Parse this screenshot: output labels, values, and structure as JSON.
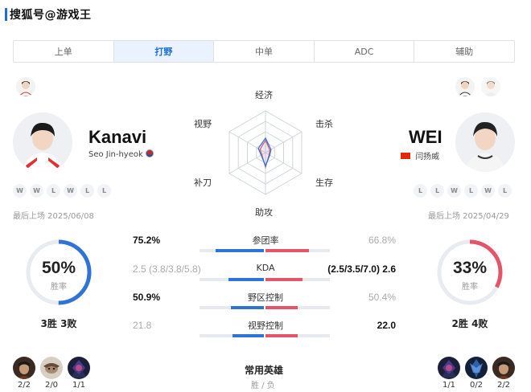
{
  "header": {
    "watermark": "搜狐号@游戏王"
  },
  "tabs": [
    {
      "label": "上单",
      "active": false
    },
    {
      "label": "打野",
      "active": true
    },
    {
      "label": "中单",
      "active": false
    },
    {
      "label": "ADC",
      "active": false
    },
    {
      "label": "辅助",
      "active": false
    }
  ],
  "left_player": {
    "name": "Kanavi",
    "realname": "Seo Jin-hyeok",
    "form": [
      "W",
      "W",
      "L",
      "W",
      "L",
      "L"
    ],
    "last_played": "最后上场 2025/06/08",
    "win_rate": "50%",
    "win_rate_value": 0.5,
    "win_rate_label": "胜率",
    "record": "3胜 3败",
    "champions": [
      {
        "record": "2/2"
      },
      {
        "record": "2/0"
      },
      {
        "record": "1/1"
      }
    ]
  },
  "right_player": {
    "name": "WEI",
    "realname": "闫扬威",
    "form": [
      "L",
      "L",
      "W",
      "L",
      "W",
      "L"
    ],
    "last_played": "最后上场 2025/04/29",
    "win_rate": "33%",
    "win_rate_value": 0.33,
    "win_rate_label": "胜率",
    "record": "2胜 4败",
    "champions": [
      {
        "record": "1/1"
      },
      {
        "record": "0/2"
      },
      {
        "record": "2/2"
      }
    ]
  },
  "radar": {
    "labels": {
      "top": "经济",
      "top_right": "击杀",
      "bottom_right": "生存",
      "bottom": "助攻",
      "bottom_left": "补刀",
      "top_left": "视野"
    },
    "left_series": [
      0.35,
      0.15,
      0.12,
      0.32,
      0.12,
      0.2
    ],
    "right_series": [
      0.3,
      0.12,
      0.1,
      0.35,
      0.1,
      0.15
    ],
    "colors": {
      "left": "#2f73d6",
      "right": "#e45569"
    }
  },
  "stats": [
    {
      "label": "参团率",
      "left": "75.2%",
      "right": "66.8%",
      "left_win": true,
      "left_bar": 0.75,
      "right_bar": 0.67
    },
    {
      "label": "KDA",
      "left": "2.5 (3.8/3.8/5.8)",
      "right": "(2.5/3.5/7.0) 2.6",
      "left_win": false,
      "left_bar": 0.55,
      "right_bar": 0.57
    },
    {
      "label": "野区控制",
      "left": "50.9%",
      "right": "50.4%",
      "left_win": true,
      "left_bar": 0.51,
      "right_bar": 0.5
    },
    {
      "label": "视野控制",
      "left": "21.8",
      "right": "22.0",
      "left_win": false,
      "left_bar": 0.49,
      "right_bar": 0.5
    }
  ],
  "common_heroes": {
    "title": "常用英雄",
    "subtitle": "胜 / 负"
  },
  "colors": {
    "accent": "#1a6fd8",
    "blue": "#2f73d6",
    "red": "#e45569"
  }
}
